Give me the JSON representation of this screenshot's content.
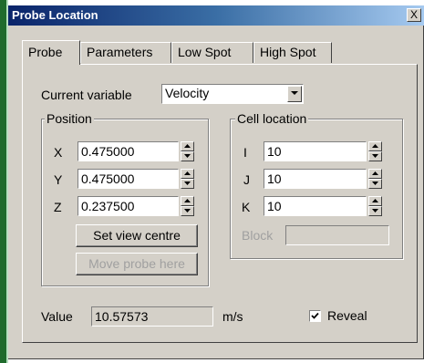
{
  "window": {
    "title": "Probe Location",
    "close_glyph": "X"
  },
  "tabs": [
    {
      "label": "Probe",
      "active": true
    },
    {
      "label": "Parameters",
      "active": false
    },
    {
      "label": "Low Spot",
      "active": false
    },
    {
      "label": "High Spot",
      "active": false
    }
  ],
  "current_variable": {
    "label": "Current variable",
    "value": "Velocity"
  },
  "position": {
    "title": "Position",
    "x": {
      "label": "X",
      "value": "0.475000"
    },
    "y": {
      "label": "Y",
      "value": "0.475000"
    },
    "z": {
      "label": "Z",
      "value": "0.237500"
    },
    "set_view_centre": "Set view centre",
    "move_probe_here": "Move probe here"
  },
  "cell_location": {
    "title": "Cell location",
    "i": {
      "label": "I",
      "value": "10"
    },
    "j": {
      "label": "J",
      "value": "10"
    },
    "k": {
      "label": "K",
      "value": "10"
    },
    "block": {
      "label": "Block",
      "value": ""
    }
  },
  "value": {
    "label": "Value",
    "value": "10.57573",
    "unit": "m/s"
  },
  "reveal": {
    "label": "Reveal",
    "checked": true
  }
}
